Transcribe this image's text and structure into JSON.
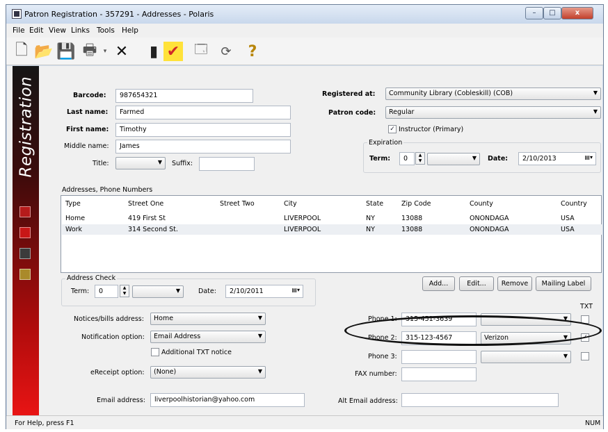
{
  "window": {
    "title": "Patron Registration - 357291 - Addresses - Polaris",
    "minimize_glyph": "–",
    "maximize_glyph": "□",
    "close_glyph": "x"
  },
  "menu": [
    "File",
    "Edit",
    "View",
    "Links",
    "Tools",
    "Help"
  ],
  "toolbar": [
    {
      "name": "new-icon",
      "glyph": "🗋"
    },
    {
      "name": "open-folder-icon",
      "glyph": "📂"
    },
    {
      "name": "save-icon",
      "glyph": "💾"
    },
    {
      "name": "print-icon",
      "glyph": "🖶"
    },
    {
      "name": "delete-icon",
      "glyph": "✕"
    },
    {
      "name": "patron-status-icon",
      "glyph": "▮"
    },
    {
      "name": "check-icon",
      "glyph": "✔"
    },
    {
      "name": "properties-icon",
      "glyph": "🗔"
    },
    {
      "name": "refresh-icon",
      "glyph": "⟳"
    },
    {
      "name": "help-icon",
      "glyph": "?"
    }
  ],
  "sidebar": {
    "title": "Registration"
  },
  "patron": {
    "barcode_label": "Barcode:",
    "barcode": "987654321",
    "last_name_label": "Last name:",
    "last_name": "Farmed",
    "first_name_label": "First name:",
    "first_name": "Timothy",
    "middle_name_label": "Middle name:",
    "middle_name": "James",
    "title_label": "Title:",
    "title": "",
    "suffix_label": "Suffix:",
    "suffix": ""
  },
  "registration": {
    "registered_at_label": "Registered at:",
    "registered_at": "Community Library (Cobleskill) (COB)",
    "patron_code_label": "Patron code:",
    "patron_code": "Regular",
    "instructor_label": "Instructor (Primary)",
    "instructor_checked": true,
    "expiration_label": "Expiration",
    "term_label": "Term:",
    "term": "0",
    "term_unit": "",
    "date_label": "Date:",
    "date": "2/10/2013"
  },
  "addresses": {
    "section_label": "Addresses, Phone Numbers",
    "columns": [
      "Type",
      "Street One",
      "Street Two",
      "City",
      "State",
      "Zip Code",
      "County",
      "Country"
    ],
    "rows": [
      [
        "Home",
        "419 First St",
        "",
        "LIVERPOOL",
        "NY",
        "13088",
        "ONONDAGA",
        "USA"
      ],
      [
        "Work",
        "314 Second St.",
        "",
        "LIVERPOOL",
        "NY",
        "13088",
        "ONONDAGA",
        "USA"
      ]
    ]
  },
  "address_check": {
    "label": "Address Check",
    "term_label": "Term:",
    "term": "0",
    "term_unit": "",
    "date_label": "Date:",
    "date": "2/10/2011"
  },
  "buttons": {
    "add": "Add...",
    "edit": "Edit...",
    "remove": "Remove",
    "mailing_label": "Mailing Label"
  },
  "notices": {
    "bills_label": "Notices/bills address:",
    "bills": "Home",
    "notification_label": "Notification option:",
    "notification": "Email Address",
    "additional_txt_label": "Additional TXT notice",
    "ereceipt_label": "eReceipt option:",
    "ereceipt": "(None)",
    "email_label": "Email address:",
    "email": "liverpoolhistorian@yahoo.com",
    "alt_email_label": "Alt Email address:",
    "alt_email": ""
  },
  "phones": {
    "txt_label": "TXT",
    "phone1_label": "Phone 1:",
    "phone1": "315-451-3639",
    "phone1_carrier": "",
    "phone2_label": "Phone 2:",
    "phone2": "315-123-4567",
    "phone2_carrier": "Verizon",
    "phone3_label": "Phone 3:",
    "phone3": "",
    "phone3_carrier": "",
    "fax_label": "FAX number:",
    "fax": ""
  },
  "status": {
    "help": "For Help, press F1",
    "num": "NUM"
  }
}
